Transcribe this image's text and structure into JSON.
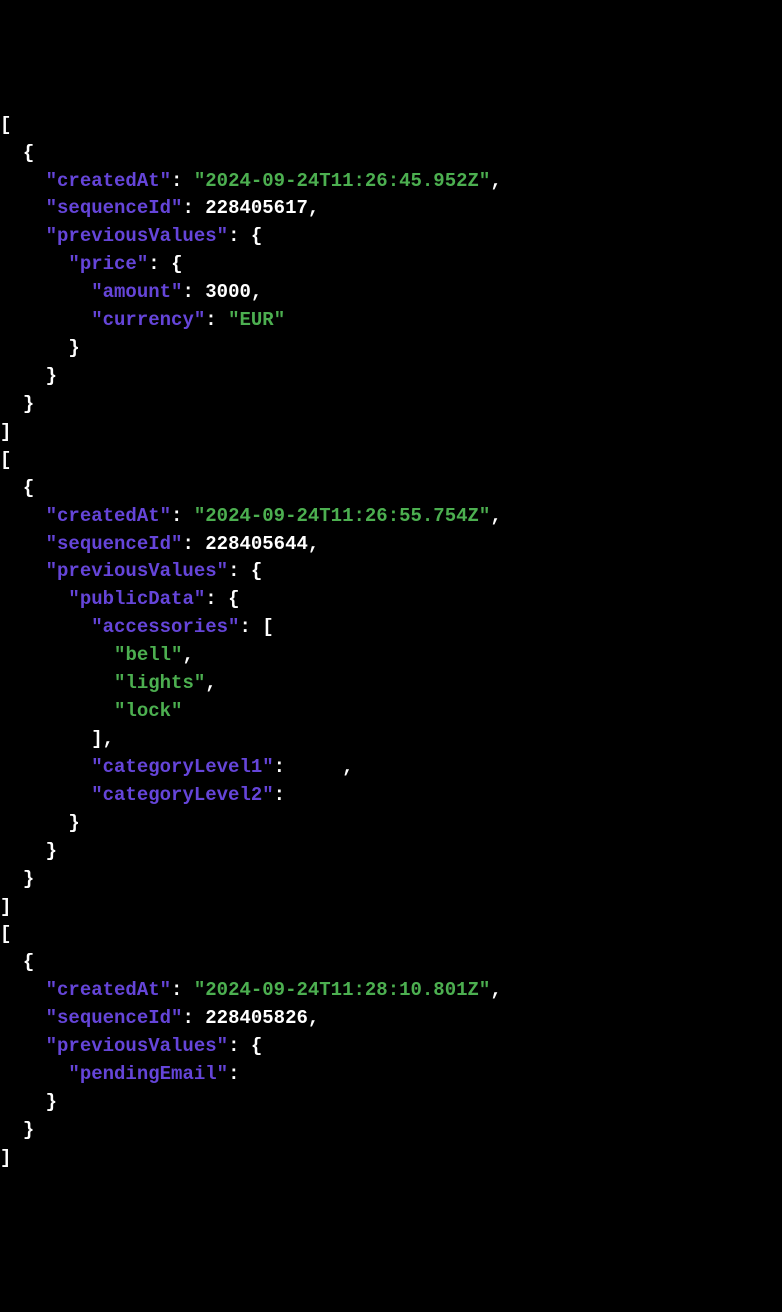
{
  "entries": [
    {
      "createdAt": "2024-09-24T11:26:45.952Z",
      "sequenceId": 228405617,
      "previousValues": {
        "price": {
          "amount": 3000,
          "currency": "EUR"
        }
      }
    },
    {
      "createdAt": "2024-09-24T11:26:55.754Z",
      "sequenceId": 228405644,
      "previousValues": {
        "publicData": {
          "accessories": [
            "bell",
            "lights",
            "lock"
          ],
          "categoryLevel1": null,
          "categoryLevel2": null
        }
      }
    },
    {
      "createdAt": "2024-09-24T11:28:10.801Z",
      "sequenceId": 228405826,
      "previousValues": {
        "pendingEmail": null
      }
    }
  ],
  "keys": {
    "createdAt": "createdAt",
    "sequenceId": "sequenceId",
    "previousValues": "previousValues",
    "price": "price",
    "amount": "amount",
    "currency": "currency",
    "publicData": "publicData",
    "accessories": "accessories",
    "categoryLevel1": "categoryLevel1",
    "categoryLevel2": "categoryLevel2",
    "pendingEmail": "pendingEmail"
  }
}
